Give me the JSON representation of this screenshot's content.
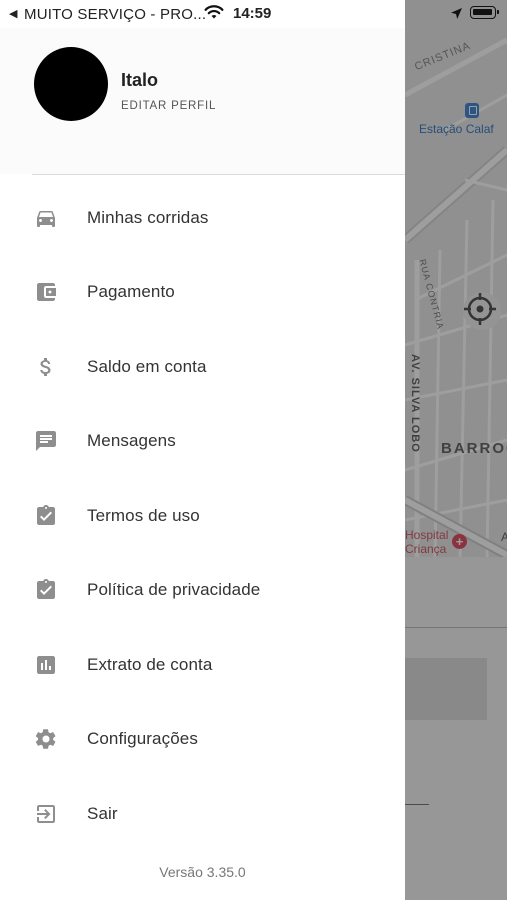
{
  "status_bar": {
    "back_glyph": "◀",
    "carrier": "MUITO SERVIÇO - PRO...",
    "time": "14:59",
    "icons": [
      "wifi-icon",
      "location-arrow-icon",
      "battery-icon"
    ]
  },
  "profile": {
    "name": "Italo",
    "edit_label": "EDITAR PERFIL"
  },
  "menu": {
    "items": [
      {
        "label": "Minhas corridas",
        "icon": "car-icon"
      },
      {
        "label": "Pagamento",
        "icon": "wallet-icon"
      },
      {
        "label": "Saldo em conta",
        "icon": "dollar-icon"
      },
      {
        "label": "Mensagens",
        "icon": "message-icon"
      },
      {
        "label": "Termos de uso",
        "icon": "clipboard-check-icon"
      },
      {
        "label": "Política de privacidade",
        "icon": "clipboard-check-icon"
      },
      {
        "label": "Extrato de conta",
        "icon": "bar-chart-icon"
      },
      {
        "label": "Configurações",
        "icon": "gear-icon"
      },
      {
        "label": "Sair",
        "icon": "exit-icon"
      }
    ]
  },
  "version": "Versão 3.35.0",
  "map": {
    "labels": {
      "street_top": "CRISTINA",
      "station": "Estação Calaf",
      "rua": "RUA CONTRIA",
      "avenue": "AV. SILVA LOBO",
      "neighborhood": "BARROC",
      "hospital_line1": "Hospital",
      "hospital_line2": "Criança",
      "edge_letter": "A"
    },
    "hospital_glyph": "+"
  },
  "colors": {
    "icon_gray": "#8e8e8e",
    "text": "#333333",
    "map_bg": "#e9e9e9",
    "station_blue": "#4a89d6",
    "hospital_red": "#e0526a"
  }
}
